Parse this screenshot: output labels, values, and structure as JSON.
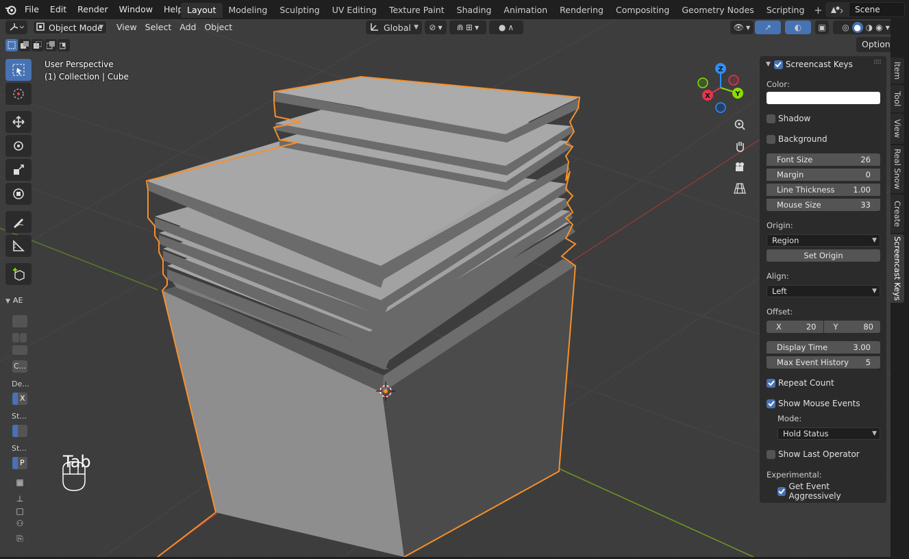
{
  "menubar": {
    "items": [
      "File",
      "Edit",
      "Render",
      "Window",
      "Help"
    ],
    "workspaces": [
      "Layout",
      "Modeling",
      "Sculpting",
      "UV Editing",
      "Texture Paint",
      "Shading",
      "Animation",
      "Rendering",
      "Compositing",
      "Geometry Nodes",
      "Scripting"
    ],
    "active_workspace": "Layout",
    "add_workspace": "+",
    "scene": "Scene"
  },
  "header": {
    "mode": "Object Mode",
    "menus": [
      "View",
      "Select",
      "Add",
      "Object"
    ],
    "orientation": "Global",
    "options": "Options"
  },
  "viewport": {
    "perspective": "User Perspective",
    "collection": "(1) Collection | Cube",
    "key_pressed": "Tab",
    "gizmo": {
      "z": "Z",
      "y": "Y",
      "x": "X"
    }
  },
  "side_panel_left": {
    "header": "AE",
    "labels": [
      "C...",
      "De...",
      "St...",
      "St..."
    ],
    "checks": [
      "X",
      "P"
    ]
  },
  "sidebar_tabs": [
    "Item",
    "Tool",
    "View",
    "Real Snow",
    "Create",
    "Screencast Keys"
  ],
  "active_sidebar_tab": "Screencast Keys",
  "screencast": {
    "title": "Screencast Keys",
    "enabled": true,
    "color_label": "Color:",
    "color": "#ffffff",
    "shadow_label": "Shadow",
    "shadow": false,
    "background_label": "Background",
    "background": false,
    "font_size_label": "Font Size",
    "font_size": "26",
    "margin_label": "Margin",
    "margin": "0",
    "line_thickness_label": "Line Thickness",
    "line_thickness": "1.00",
    "mouse_size_label": "Mouse Size",
    "mouse_size": "33",
    "origin_label": "Origin:",
    "origin": "Region",
    "set_origin": "Set Origin",
    "align_label": "Align:",
    "align": "Left",
    "offset_label": "Offset:",
    "offset_x_label": "X",
    "offset_x": "20",
    "offset_y_label": "Y",
    "offset_y": "80",
    "display_time_label": "Display Time",
    "display_time": "3.00",
    "max_event_history_label": "Max Event History",
    "max_event_history": "5",
    "repeat_count_label": "Repeat Count",
    "repeat_count": true,
    "show_mouse_events_label": "Show Mouse Events",
    "show_mouse_events": true,
    "mode_label": "Mode:",
    "mode": "Hold Status",
    "show_last_operator_label": "Show Last Operator",
    "show_last_operator": false,
    "experimental_label": "Experimental:",
    "get_event_aggressively_label": "Get Event Aggressively",
    "get_event_aggressively": true
  },
  "colors": {
    "accent": "#4772b3",
    "selection_outline": "#f5902c",
    "x_axis": "#e8344e",
    "y_axis": "#8bdc00",
    "z_axis": "#2c8fff"
  }
}
